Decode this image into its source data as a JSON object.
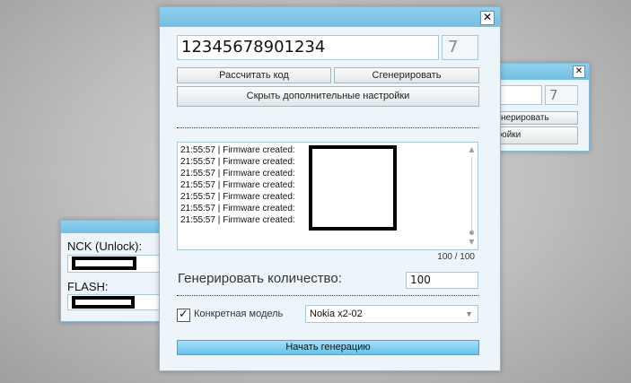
{
  "main": {
    "close_symbol": "✕",
    "imei": "12345678901234",
    "check_digit": "7",
    "btn_calculate": "Рассчитать код",
    "btn_generate": "Сгенерировать",
    "btn_hide_settings": "Скрыть дополнительные настройки",
    "log_lines": [
      "21:55:57  |  Firmware created:",
      "21:55:57  |  Firmware created:",
      "21:55:57  |  Firmware created:",
      "21:55:57  |  Firmware created:",
      "21:55:57  |  Firmware created:",
      "21:55:57  |  Firmware created:",
      "21:55:57  |  Firmware created:"
    ],
    "scroll_up_symbol": "▲",
    "scroll_down_symbol": "▼",
    "log_counter": "100 / 100",
    "quantity_label": "Генерировать количество:",
    "quantity_value": "100",
    "checkbox_mark": "✓",
    "model_checkbox_label": "Конкретная модель",
    "model_select_value": "Nokia x2-02",
    "select_arrow_symbol": "▼",
    "start_button": "Начать генерацию"
  },
  "back_right": {
    "close_symbol": "✕",
    "check_digit": "7",
    "btn_generate_partial": "генерировать",
    "btn_settings_partial": "тройки"
  },
  "back_left": {
    "nck_label": "NCK (Unlock):",
    "flash_label": "FLASH:"
  },
  "colors": {
    "titlebar": "#7cc6e9",
    "primary_button": "#62c3ec",
    "window_bg": "#eef5fa",
    "field_border": "#a7c8da"
  }
}
